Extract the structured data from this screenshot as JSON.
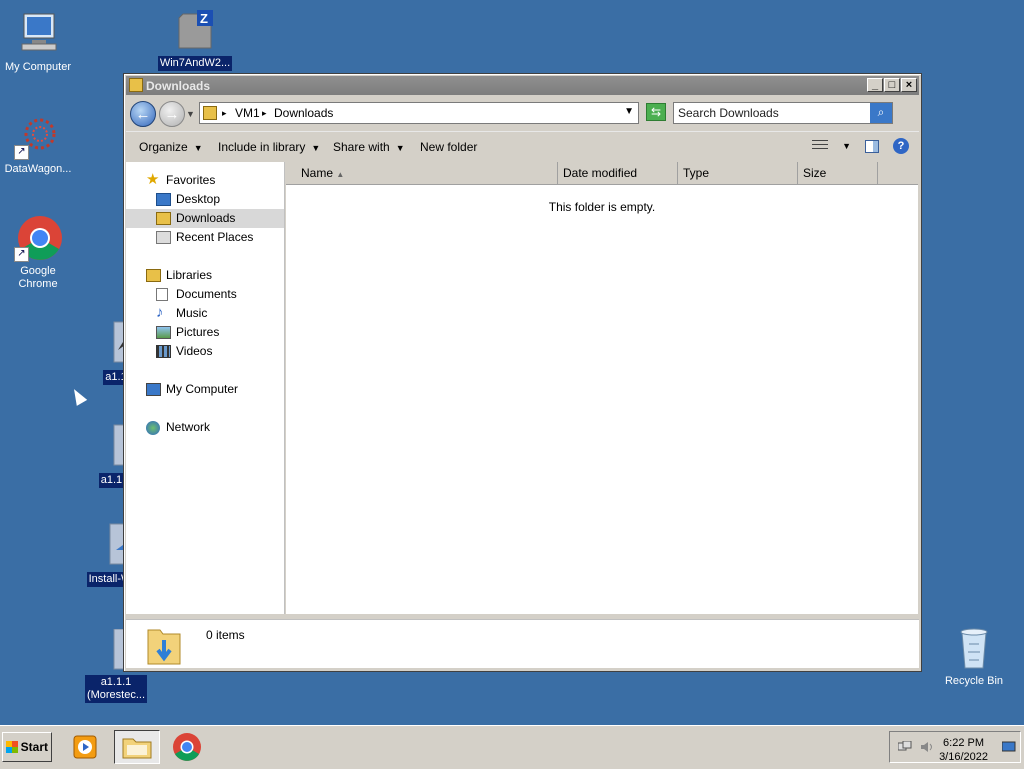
{
  "desktop": {
    "icons": [
      {
        "label": "My Computer"
      },
      {
        "label": "Win7AndW2..."
      },
      {
        "label": "DataWagon..."
      },
      {
        "label": "Google Chrome"
      },
      {
        "label": "a1.1"
      },
      {
        "label": "a1.1.1"
      },
      {
        "label": "Install-W"
      },
      {
        "label": "a1.1.1\n(Morestec..."
      },
      {
        "label": "Recycle Bin"
      }
    ]
  },
  "window": {
    "title": "Downloads",
    "controls": {
      "minimize": "_",
      "maximize": "□",
      "close": "×"
    },
    "address": {
      "segments": [
        "VM1",
        "Downloads"
      ]
    },
    "search": {
      "placeholder": "Search Downloads"
    },
    "toolbar": {
      "organize": "Organize",
      "include_in_library": "Include in library",
      "share_with": "Share with",
      "new_folder": "New folder"
    },
    "nav": {
      "favorites": "Favorites",
      "desktop": "Desktop",
      "downloads": "Downloads",
      "recent_places": "Recent Places",
      "libraries": "Libraries",
      "documents": "Documents",
      "music": "Music",
      "pictures": "Pictures",
      "videos": "Videos",
      "my_computer": "My Computer",
      "network": "Network"
    },
    "columns": [
      "Name",
      "Date modified",
      "Type",
      "Size"
    ],
    "empty_message": "This folder is empty.",
    "details": {
      "item_count": "0 items"
    }
  },
  "taskbar": {
    "start_label": "Start",
    "clock": {
      "time": "6:22 PM",
      "date": "3/16/2022"
    }
  }
}
